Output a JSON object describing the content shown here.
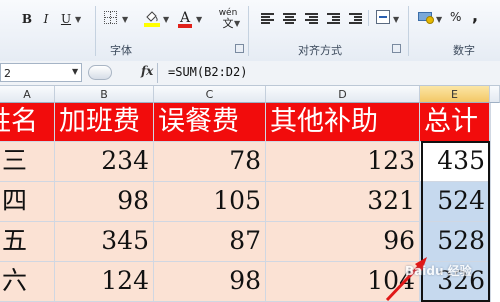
{
  "ribbon": {
    "font_buttons": {
      "bold": "B",
      "italic": "I",
      "underline": "U"
    },
    "font_color_letter": "A",
    "wrap_label": "wén",
    "font_group_label": "字体",
    "align_group_label": "对齐方式",
    "number_group_label": "数字",
    "percent": "%",
    "comma": ","
  },
  "formula_bar": {
    "name_box": "2",
    "fx": "fx",
    "formula": "=SUM(B2:D2)"
  },
  "columns": [
    "A",
    "B",
    "C",
    "D",
    "E"
  ],
  "selected_column": "E",
  "header_row": [
    "姓名",
    "加班费",
    "误餐费",
    "其他补助",
    "总计"
  ],
  "rows": [
    {
      "name": "三",
      "b": "234",
      "c": "78",
      "d": "123",
      "e": "435"
    },
    {
      "name": "四",
      "b": "98",
      "c": "105",
      "d": "321",
      "e": "524"
    },
    {
      "name": "五",
      "b": "345",
      "c": "87",
      "d": "96",
      "e": "528"
    },
    {
      "name": "六",
      "b": "124",
      "c": "98",
      "d": "104",
      "e": "326"
    }
  ],
  "watermark": "Baidu 经验",
  "colors": {
    "header_fill": "#f20c0c",
    "data_fill": "#fbe2d4",
    "selection_fill": "#c6d9ee",
    "font_color_bar": "#e0211b",
    "fill_color_bar": "#ffff00"
  }
}
